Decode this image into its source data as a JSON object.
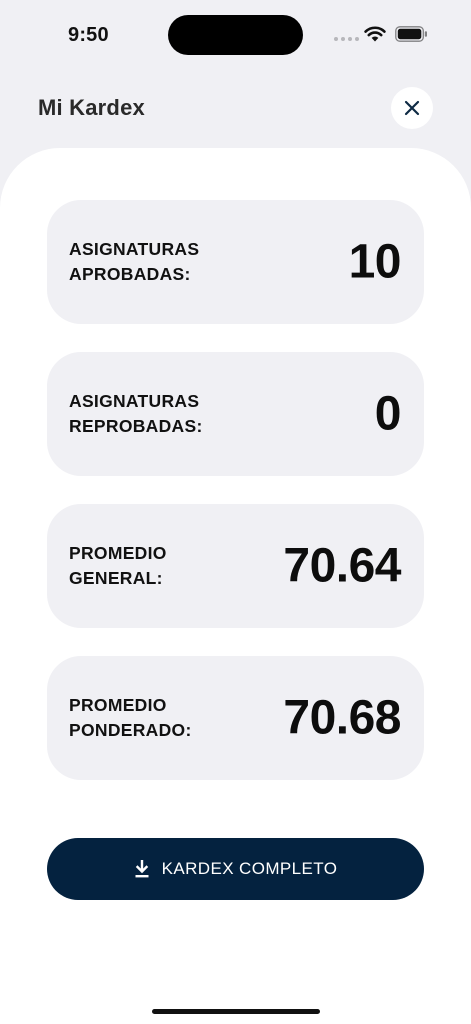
{
  "status_bar": {
    "time": "9:50"
  },
  "header": {
    "title": "Mi Kardex",
    "close_icon": "close-icon"
  },
  "stats": [
    {
      "label": "ASIGNATURAS APROBADAS:",
      "value": "10"
    },
    {
      "label": "ASIGNATURAS REPROBADAS:",
      "value": "0"
    },
    {
      "label": "PROMEDIO GENERAL:",
      "value": "70.64"
    },
    {
      "label": "PROMEDIO PONDERADO:",
      "value": "70.68"
    }
  ],
  "download_button": {
    "label": "KARDEX COMPLETO",
    "icon": "download-icon"
  },
  "colors": {
    "background": "#f0f0f4",
    "sheet": "#ffffff",
    "card": "#f0f0f4",
    "primary": "#04223f",
    "text": "#111111"
  }
}
